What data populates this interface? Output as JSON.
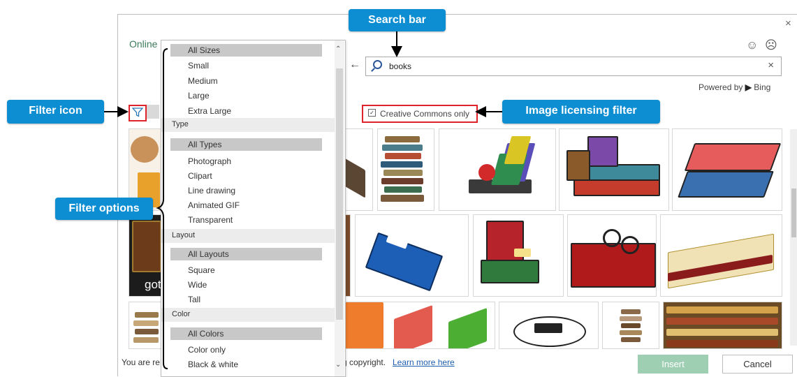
{
  "dialog": {
    "title": "Online",
    "close": "×",
    "smile": "☺",
    "frown": "☹"
  },
  "search": {
    "value": "books",
    "clear": "×",
    "back": "←"
  },
  "powered": {
    "text": "Powered by",
    "brand": "Bing"
  },
  "license_filter": {
    "label": "Creative Commons only",
    "checked": true
  },
  "filter_menu": {
    "size_header_selected": "All Sizes",
    "sizes": [
      "Small",
      "Medium",
      "Large",
      "Extra Large"
    ],
    "type_header": "Type",
    "type_selected": "All Types",
    "types": [
      "Photograph",
      "Clipart",
      "Line drawing",
      "Animated GIF",
      "Transparent"
    ],
    "layout_header": "Layout",
    "layout_selected": "All Layouts",
    "layouts": [
      "Square",
      "Wide",
      "Tall"
    ],
    "color_header": "Color",
    "color_selected": "All Colors",
    "colors": [
      "Color only",
      "Black & white"
    ]
  },
  "thumb_partial_text": "got",
  "footer": {
    "text_start": "You are re",
    "text_end": "g copyright.",
    "learn_more": "Learn more here",
    "insert": "Insert",
    "cancel": "Cancel"
  },
  "callouts": {
    "search_bar": "Search bar",
    "filter_icon": "Filter icon",
    "image_licensing": "Image licensing filter",
    "filter_options": "Filter options"
  },
  "colors": {
    "callout": "#0d8ed3",
    "highlight": "#e0232a",
    "insert_button": "#9fcfb3",
    "title": "#3d7b5b"
  }
}
